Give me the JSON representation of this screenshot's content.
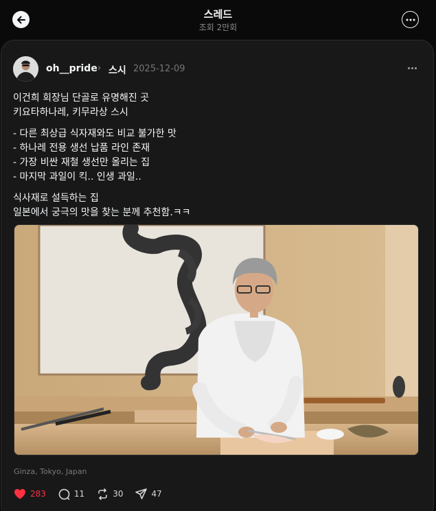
{
  "header": {
    "title": "스레드",
    "subtitle": "조회 2만회"
  },
  "post": {
    "username": "oh__pride",
    "topic": "스시",
    "date": "2025-12-09",
    "paragraphs": [
      [
        "이건희 회장님 단골로 유명해진 곳",
        "키요타하나레, 키무라상 스시"
      ],
      [
        "- 다른 최상급 식자재와도 비교 불가한 맛",
        "- 하나레 전용 생선 납품 라인 존재",
        "- 가장 비싼 재철 생선만 올리는 집",
        "- 마지막 과일이 킥.. 인생 과일.."
      ],
      [
        "식사재로 설득하는 집",
        "일본에서 궁극의 맛을 찾는 분께 추천함.ㅋㅋ"
      ]
    ],
    "location": "Ginza, Tokyo, Japan",
    "counts": {
      "likes": "283",
      "comments": "11",
      "reposts": "30",
      "shares": "47"
    }
  },
  "icons": {
    "back": "arrow-left-icon",
    "more": "more-horizontal-icon",
    "like": "heart-icon",
    "comment": "comment-icon",
    "repost": "repost-icon",
    "share": "send-icon"
  },
  "colors": {
    "background": "#0a0a0a",
    "card": "#181818",
    "like_active": "#ff3040",
    "text_primary": "#f3f5f7",
    "text_secondary": "#8a8a8a"
  }
}
